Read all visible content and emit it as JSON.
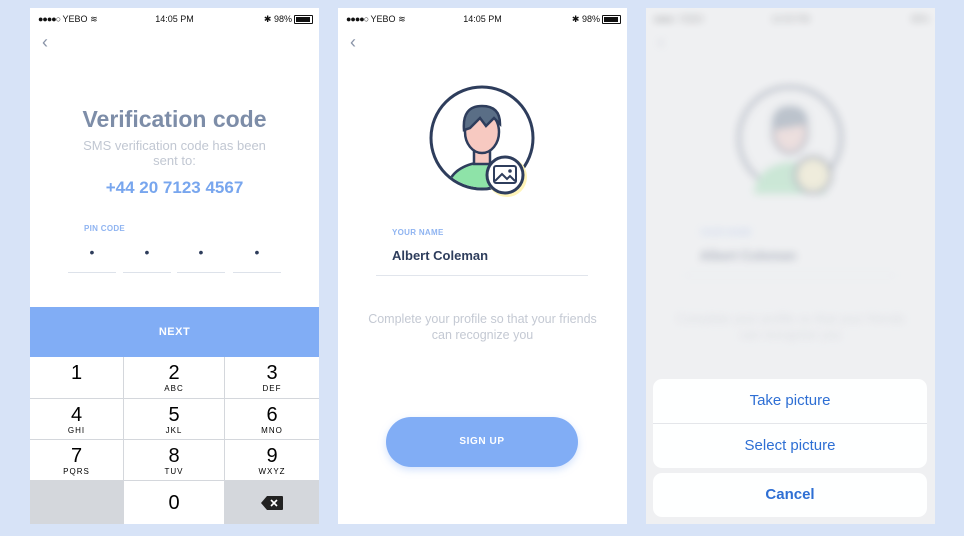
{
  "status_bar": {
    "carrier": "YEBO",
    "signal": "●●●●○",
    "time": "14:05 PM",
    "battery": "98%"
  },
  "screen1": {
    "back_icon": "‹",
    "title": "Verification code",
    "subtitle": "SMS verification code has been sent to:",
    "phone": "+44 20 7123 4567",
    "pin_label": "PIN CODE",
    "pin_digits": [
      "•",
      "•",
      "•",
      "•"
    ],
    "next_label": "NEXT",
    "keypad": [
      {
        "num": "1",
        "letters": ""
      },
      {
        "num": "2",
        "letters": "ABC"
      },
      {
        "num": "3",
        "letters": "DEF"
      },
      {
        "num": "4",
        "letters": "GHI"
      },
      {
        "num": "5",
        "letters": "JKL"
      },
      {
        "num": "6",
        "letters": "MNO"
      },
      {
        "num": "7",
        "letters": "PQRS"
      },
      {
        "num": "8",
        "letters": "TUV"
      },
      {
        "num": "9",
        "letters": "WXYZ"
      },
      {
        "num": "0",
        "letters": ""
      }
    ]
  },
  "screen2": {
    "back_icon": "‹",
    "name_label": "YOUR NAME",
    "name_value": "Albert Coleman",
    "hint": "Complete your profile so that your friends can recognize you",
    "signup_label": "SIGN UP"
  },
  "screen3": {
    "take_picture": "Take picture",
    "select_picture": "Select picture",
    "cancel": "Cancel"
  },
  "colors": {
    "accent": "#81adf5",
    "title": "#7d8da8",
    "ios_blue": "#2e6fd4",
    "background": "#d7e3f7"
  }
}
